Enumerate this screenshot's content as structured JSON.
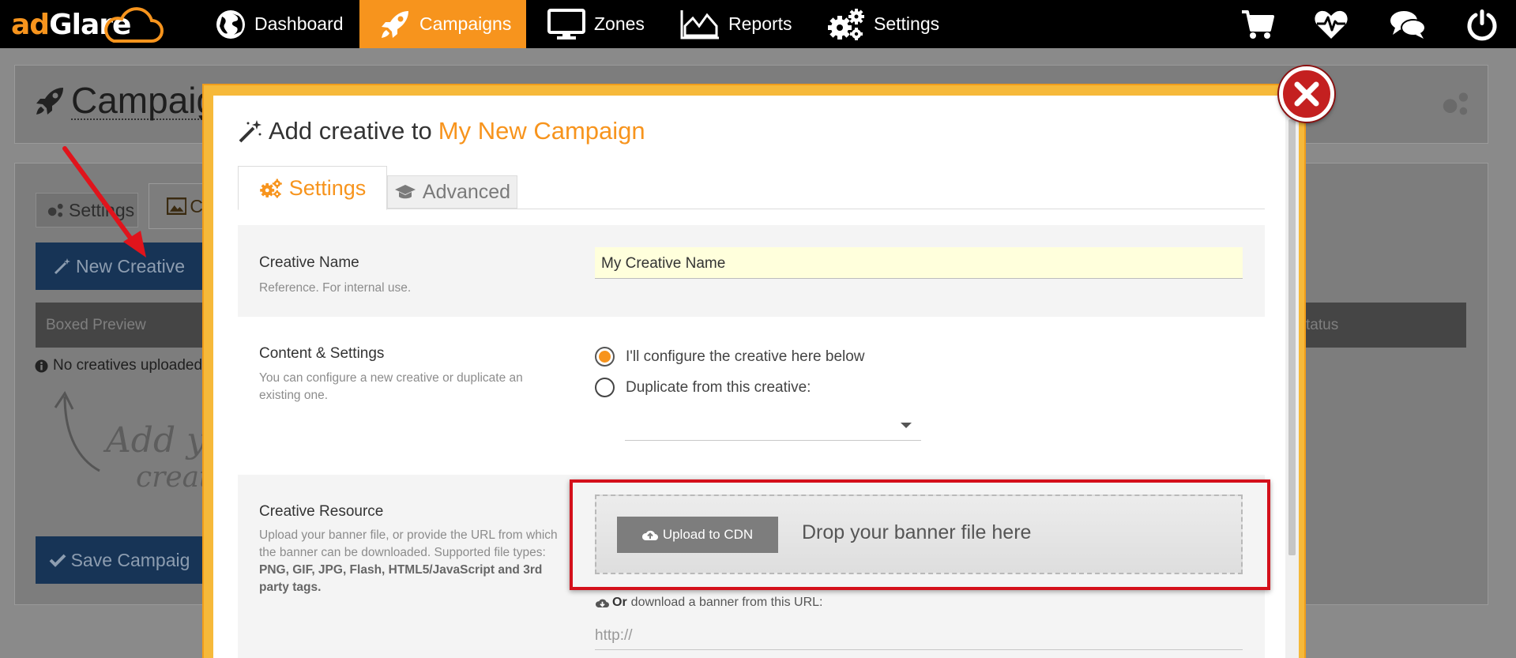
{
  "topnav": {
    "logo": "adGlare",
    "items": [
      {
        "label": "Dashboard",
        "icon": "globe-icon"
      },
      {
        "label": "Campaigns",
        "icon": "rocket-icon",
        "active": true
      },
      {
        "label": "Zones",
        "icon": "monitor-icon"
      },
      {
        "label": "Reports",
        "icon": "area-chart-icon"
      },
      {
        "label": "Settings",
        "icon": "gears-icon"
      }
    ],
    "right_icons": [
      "cart-icon",
      "heartbeat-icon",
      "chat-icon",
      "power-icon"
    ],
    "accent": "#f7941d"
  },
  "background_page": {
    "title": "Campaign",
    "tabs": [
      "Settings",
      "C"
    ],
    "new_creative_label": "New Creative",
    "table_headers": [
      "Boxed Preview",
      "tatus"
    ],
    "empty_note": "No creatives uploaded",
    "handwritten_hint": "Add you\ncreat",
    "save_label": "Save Campaig"
  },
  "modal": {
    "title_prefix": "Add creative to",
    "campaign_name": "My New Campaign",
    "tabs": {
      "active": "Settings",
      "inactive": "Advanced"
    },
    "creative_name": {
      "label": "Creative Name",
      "help": "Reference. For internal use.",
      "value": "My Creative Name"
    },
    "content_settings": {
      "label": "Content & Settings",
      "help": "You can configure a new creative or duplicate an existing one.",
      "option_configure": "I'll configure the creative here below",
      "option_duplicate": "Duplicate from this creative:"
    },
    "creative_resource": {
      "label": "Creative Resource",
      "help_prefix": "Upload your banner file, or provide the URL from which the banner can be downloaded. Supported file types:",
      "help_types": "PNG, GIF, JPG, Flash, HTML5/JavaScript and 3rd party tags.",
      "upload_button": "Upload to CDN",
      "drop_text": "Drop your banner file here",
      "or_label": "Or",
      "or_text": "download a banner from this URL:",
      "url_placeholder": "http://"
    },
    "highlight_color": "#d4101b"
  }
}
